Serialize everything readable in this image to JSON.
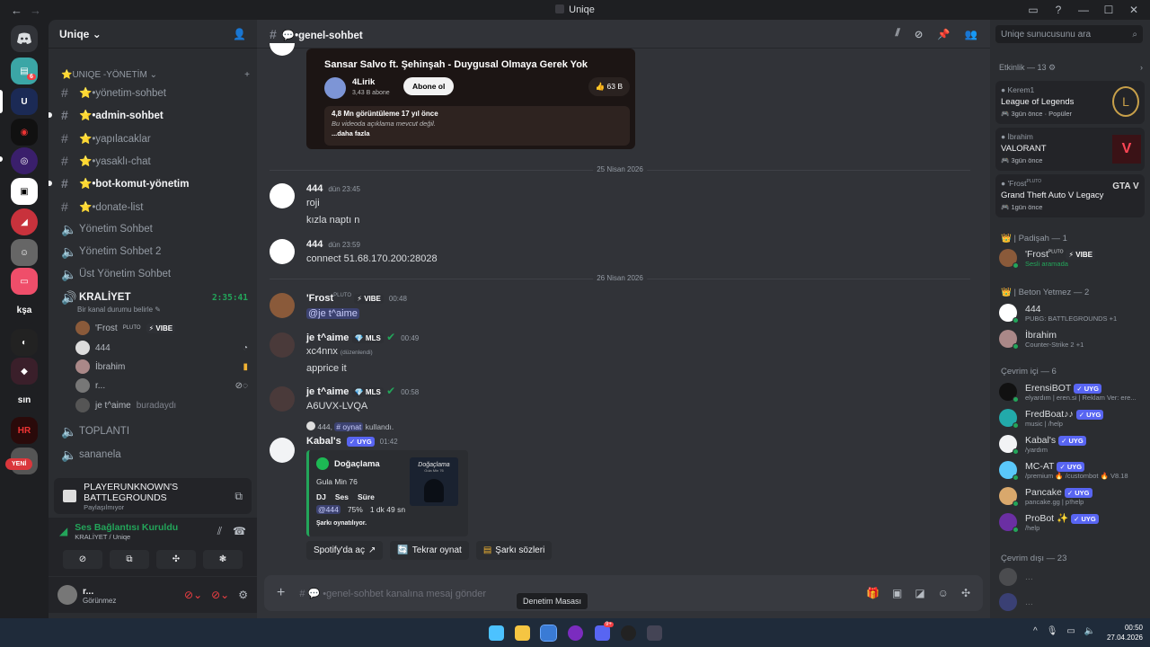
{
  "window": {
    "title": "Uniqe"
  },
  "server": {
    "name": "Uniqe",
    "dm_badge": "6",
    "new_label": "YENİ"
  },
  "guild_labels": {
    "ksa": "kşa",
    "sin": "sın"
  },
  "sidebar": {
    "category": "UNIQE -YÖNETİM",
    "channels": [
      {
        "name": "⭐•yönetim-sohbet",
        "type": "text"
      },
      {
        "name": "⭐•admin-sohbet",
        "type": "text",
        "bold": true
      },
      {
        "name": "⭐•yapılacaklar",
        "type": "text"
      },
      {
        "name": "⭐•yasaklı-chat",
        "type": "text"
      },
      {
        "name": "⭐•bot-komut-yönetim",
        "type": "text",
        "bold": true
      },
      {
        "name": "⭐•donate-list",
        "type": "text"
      },
      {
        "name": "Yönetim Sohbet",
        "type": "voice"
      },
      {
        "name": "Yönetim Sohbet 2",
        "type": "voice"
      },
      {
        "name": "Üst Yönetim Sohbet",
        "type": "voice"
      }
    ],
    "active_voice": {
      "name": "KRALİYET",
      "timer": "2:35:41",
      "status_hint": "Bir kanal durumu belirle"
    },
    "voice_users": [
      {
        "name": "'Frost",
        "tag": "PLUTO",
        "badge": "⚡ VIBE"
      },
      {
        "name": "444"
      },
      {
        "name": "İbrahim"
      },
      {
        "name": "r..."
      },
      {
        "name": "je t^aime",
        "suffix": "buradaydı"
      }
    ],
    "voice_channels_after": [
      "TOPLANTI",
      "sananela"
    ]
  },
  "activity_panel": {
    "game": "PLAYERUNKNOWN'S BATTLEGROUNDS",
    "sub": "Paylaşılmıyor"
  },
  "voice_panel": {
    "status": "Ses Bağlantısı Kuruldu",
    "location": "KRALİYET / Uniqe"
  },
  "user_panel": {
    "name": "r...",
    "status": "Görünmez"
  },
  "channel": {
    "name": "•genel-sohbet",
    "composer_placeholder": "# 💬 •genel-sohbet kanalına mesaj gönder"
  },
  "video_embed": {
    "title": "Sansar Salvo ft. Şehinşah - Duygusal Olmaya Gerek Yok",
    "channel": "4Lirik",
    "subs": "3,43 B abone",
    "subscribe": "Abone ol",
    "likes": "63 B",
    "views": "4,8 Mn görüntüleme  17 yıl önce",
    "desc": "Bu videoda açıklama mevcut değil.",
    "more": "...daha fazla"
  },
  "dividers": [
    "25 Nisan 2026",
    "26 Nisan 2026"
  ],
  "messages": [
    {
      "author": "444",
      "time": "dün 23:45",
      "lines": [
        "roji",
        "kızla naptı n"
      ]
    },
    {
      "author": "444",
      "time": "dün 23:59",
      "lines": [
        "connect 51.68.170.200:28028"
      ]
    },
    {
      "author": "'Frost",
      "author_tag": "PLUTO",
      "badge": "⚡ VIBE",
      "time": "00:48",
      "mention": "@je t^aime"
    },
    {
      "author": "je t^aime",
      "badge": "💎 MLS",
      "time": "00:49",
      "lines": [
        "xc4nnx",
        "apprice it"
      ],
      "edited": "(düzenlendi)"
    },
    {
      "author": "je t^aime",
      "badge": "💎 MLS",
      "time": "00:58",
      "lines": [
        "A6UVX-LVQA"
      ]
    }
  ],
  "bot_message": {
    "reply_user": "444",
    "reply_cmd": "# oynat",
    "reply_suffix": "kullandı.",
    "author": "Kabal's",
    "badge": "✓ UYG",
    "time": "01:42",
    "song": "Doğaçlama",
    "artist": "Gula Min 76",
    "cols": [
      "DJ",
      "Ses",
      "Süre"
    ],
    "vals": [
      "@444",
      "75%",
      "1 dk 49 sn"
    ],
    "playing": "Şarkı oynatılıyor.",
    "buttons": [
      "Spotify'da aç",
      "Tekrar oynat",
      "Şarkı sözleri"
    ],
    "cover_text": "Doğaçlama",
    "cover_sub": "Gula Min 76"
  },
  "members": {
    "search": "Uniqe sunucusunu ara",
    "activity_header": "Etkinlik — 13",
    "activities": [
      {
        "who": "Kerem1",
        "game": "League of Legends",
        "ago": "3gün önce",
        "extra": "Popüler"
      },
      {
        "who": "İbrahim",
        "game": "VALORANT",
        "ago": "3gün önce"
      },
      {
        "who": "'Frost",
        "who_tag": "PLUTO",
        "game": "Grand Theft Auto V Legacy",
        "ago": "1gün önce"
      }
    ],
    "groups": [
      {
        "title": "| Padişah — 1",
        "items": [
          {
            "name": "'Frost",
            "tag": "PLUTO",
            "badge": "⚡ VIBE",
            "sub": "Sesli aramada"
          }
        ]
      },
      {
        "title": "| Beton Yetmez — 2",
        "items": [
          {
            "name": "444",
            "sub": "PUBG: BATTLEGROUNDS +1"
          },
          {
            "name": "İbrahim",
            "sub": "Counter-Strike 2 +1"
          }
        ]
      },
      {
        "title": "Çevrim içi — 6",
        "items": [
          {
            "name": "ErensiBOT",
            "badge": "✓ UYG",
            "sub": "elyardım | eren.si | Reklam Ver: ere..."
          },
          {
            "name": "FredBoat♪♪",
            "badge": "✓ UYG",
            "sub": "music | /help"
          },
          {
            "name": "Kabal's",
            "badge": "✓ UYG",
            "sub": "/yardım"
          },
          {
            "name": "MC-AT",
            "badge": "✓ UYG",
            "sub": "/premium 🔥 /custombot 🔥 V8.18"
          },
          {
            "name": "Pancake",
            "badge": "✓ UYG",
            "sub": "pancake.gg | p!help"
          },
          {
            "name": "ProBot ✨",
            "badge": "✓ UYG",
            "sub": "/help"
          }
        ]
      },
      {
        "title": "Çevrim dışı — 23",
        "items": []
      }
    ]
  },
  "tooltip": "Denetim Masası",
  "taskbar": {
    "time": "00:50",
    "date": "27.04.2026",
    "discord_badge": "9+"
  }
}
